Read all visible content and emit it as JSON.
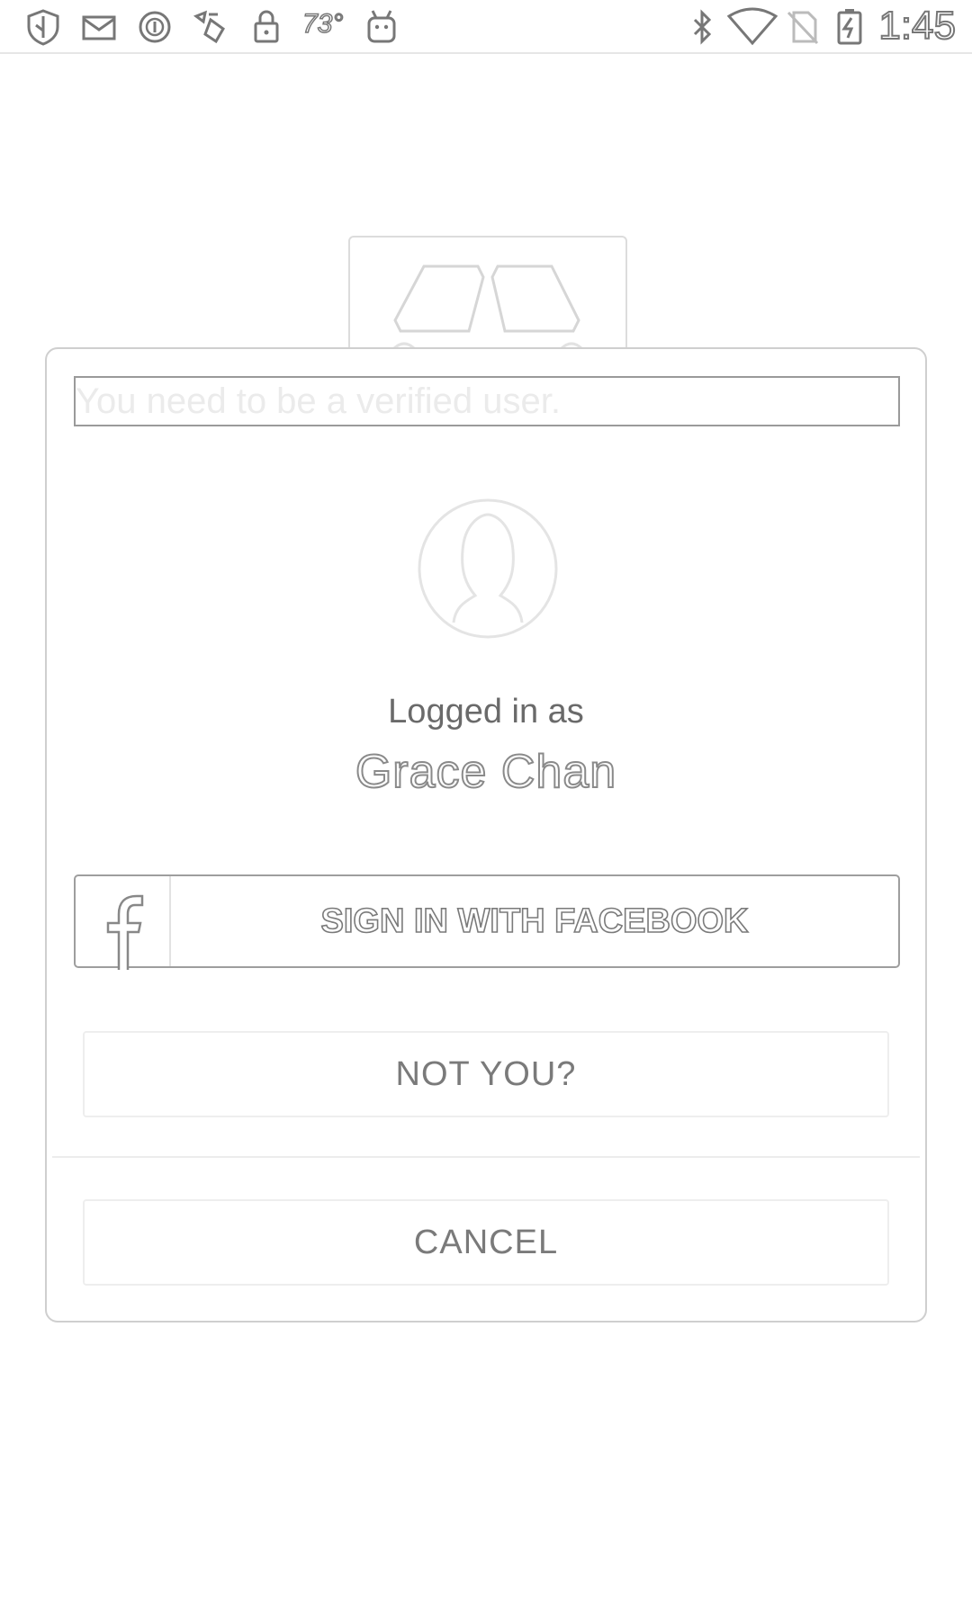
{
  "status_bar": {
    "left_icons": [
      "shield-check-icon",
      "mail-icon",
      "circle-info-icon",
      "weather-app-icon",
      "lock-icon",
      "temperature-badge",
      "android-icon"
    ],
    "temperature": "73°",
    "right_icons": [
      "bluetooth-icon",
      "wifi-icon",
      "no-sim-icon",
      "battery-charging-icon"
    ],
    "time": "1:45"
  },
  "background": {
    "logo_icon": "app-logo-icon"
  },
  "dialog": {
    "message": "You need to be a verified user.",
    "avatar_icon": "default-avatar-icon",
    "logged_in_label": "Logged in as",
    "user_name": "Grace Chan",
    "facebook_button_label": "SIGN IN WITH FACEBOOK",
    "not_you_label": "NOT YOU?",
    "cancel_label": "CANCEL"
  }
}
